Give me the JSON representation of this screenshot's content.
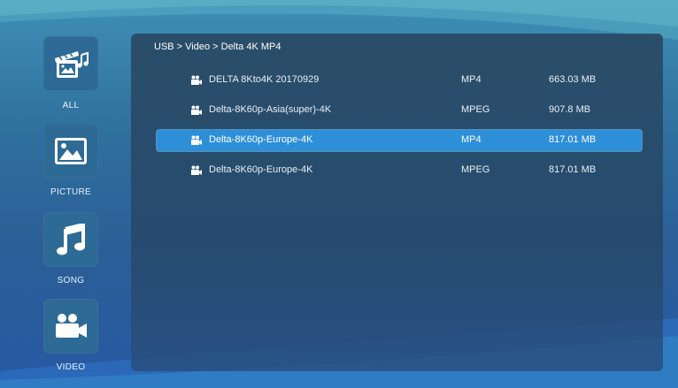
{
  "nav": {
    "items": [
      {
        "label": "ALL",
        "icon": "media-collage-icon"
      },
      {
        "label": "PICTURE",
        "icon": "picture-icon"
      },
      {
        "label": "SONG",
        "icon": "music-note-icon"
      },
      {
        "label": "VIDEO",
        "icon": "video-camera-icon"
      }
    ]
  },
  "breadcrumb": "USB > Video > Delta 4K MP4",
  "files": [
    {
      "name": "DELTA 8Kto4K 20170929",
      "format": "MP4",
      "size": "663.03 MB"
    },
    {
      "name": "Delta-8K60p-Asia(super)-4K",
      "format": "MPEG",
      "size": "907.8 MB"
    },
    {
      "name": "Delta-8K60p-Europe-4K",
      "format": "MP4",
      "size": "817.01 MB",
      "selected": true
    },
    {
      "name": "Delta-8K60p-Europe-4K",
      "format": "MPEG",
      "size": "817.01 MB"
    }
  ],
  "colors": {
    "background": "#2f6f9e",
    "panel": "#283f58",
    "selection": "#2e8fd9",
    "tile": "#2d6a95"
  }
}
